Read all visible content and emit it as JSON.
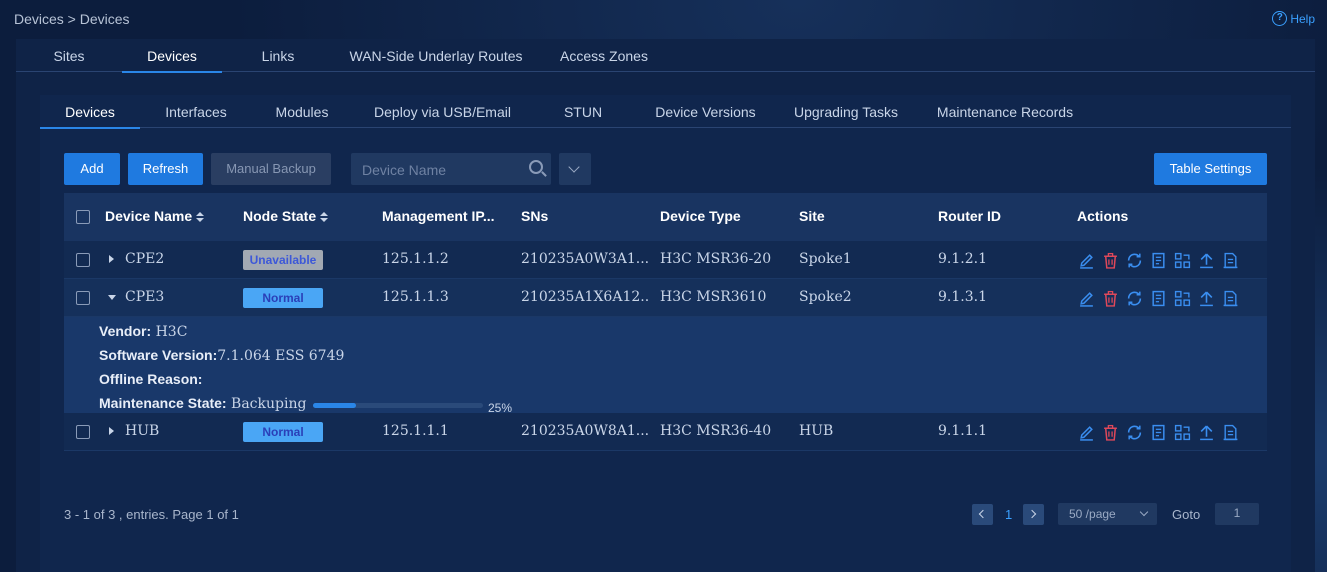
{
  "breadcrumb": "Devices > Devices",
  "help_label": "Help",
  "top_tabs": [
    "Sites",
    "Devices",
    "Links",
    "WAN-Side Underlay Routes",
    "Access Zones"
  ],
  "sub_tabs": [
    "Devices",
    "Interfaces",
    "Modules",
    "Deploy via USB/Email",
    "STUN",
    "Device Versions",
    "Upgrading Tasks",
    "Maintenance Records"
  ],
  "toolbar": {
    "add": "Add",
    "refresh": "Refresh",
    "manual_backup": "Manual Backup",
    "search_placeholder": "Device Name",
    "table_settings": "Table Settings"
  },
  "columns": [
    "Device Name",
    "Node State",
    "Management IP...",
    "SNs",
    "Device Type",
    "Site",
    "Router ID",
    "Actions"
  ],
  "rows": [
    {
      "name": "CPE2",
      "state": "Unavailable",
      "ip": "125.1.1.2",
      "sn": "210235A0W3A1...",
      "type": "H3C MSR36-20",
      "site": "Spoke1",
      "router_id": "9.1.2.1"
    },
    {
      "name": "CPE3",
      "state": "Normal",
      "ip": "125.1.1.3",
      "sn": "210235A1X6A12...",
      "type": "H3C MSR3610",
      "site": "Spoke2",
      "router_id": "9.1.3.1"
    },
    {
      "name": "HUB",
      "state": "Normal",
      "ip": "125.1.1.1",
      "sn": "210235A0W8A1...",
      "type": "H3C MSR36-40",
      "site": "HUB",
      "router_id": "9.1.1.1"
    }
  ],
  "detail": {
    "vendor_label": "Vendor:",
    "vendor": " H3C",
    "software_label": "Software Version:",
    "software": "7.1.064 ESS 6749",
    "offline_label": "Offline Reason:",
    "offline": "",
    "maint_label": "Maintenance State:",
    "maint": " Backuping",
    "progress": 0.25,
    "progress_text": "25%"
  },
  "pagination": {
    "info": "3 - 1 of 3 , entries. Page 1 of 1",
    "page": "1",
    "page_size": "50 /page",
    "goto_label": "Goto",
    "goto_value": "1"
  },
  "colors": {
    "accent": "#1f7ae0",
    "edit": "#3a8ef0",
    "delete": "#e0485a"
  },
  "action_icons": [
    "edit-icon",
    "delete-icon",
    "sync-icon",
    "config-icon",
    "topology-icon",
    "upgrade-icon",
    "log-icon"
  ]
}
